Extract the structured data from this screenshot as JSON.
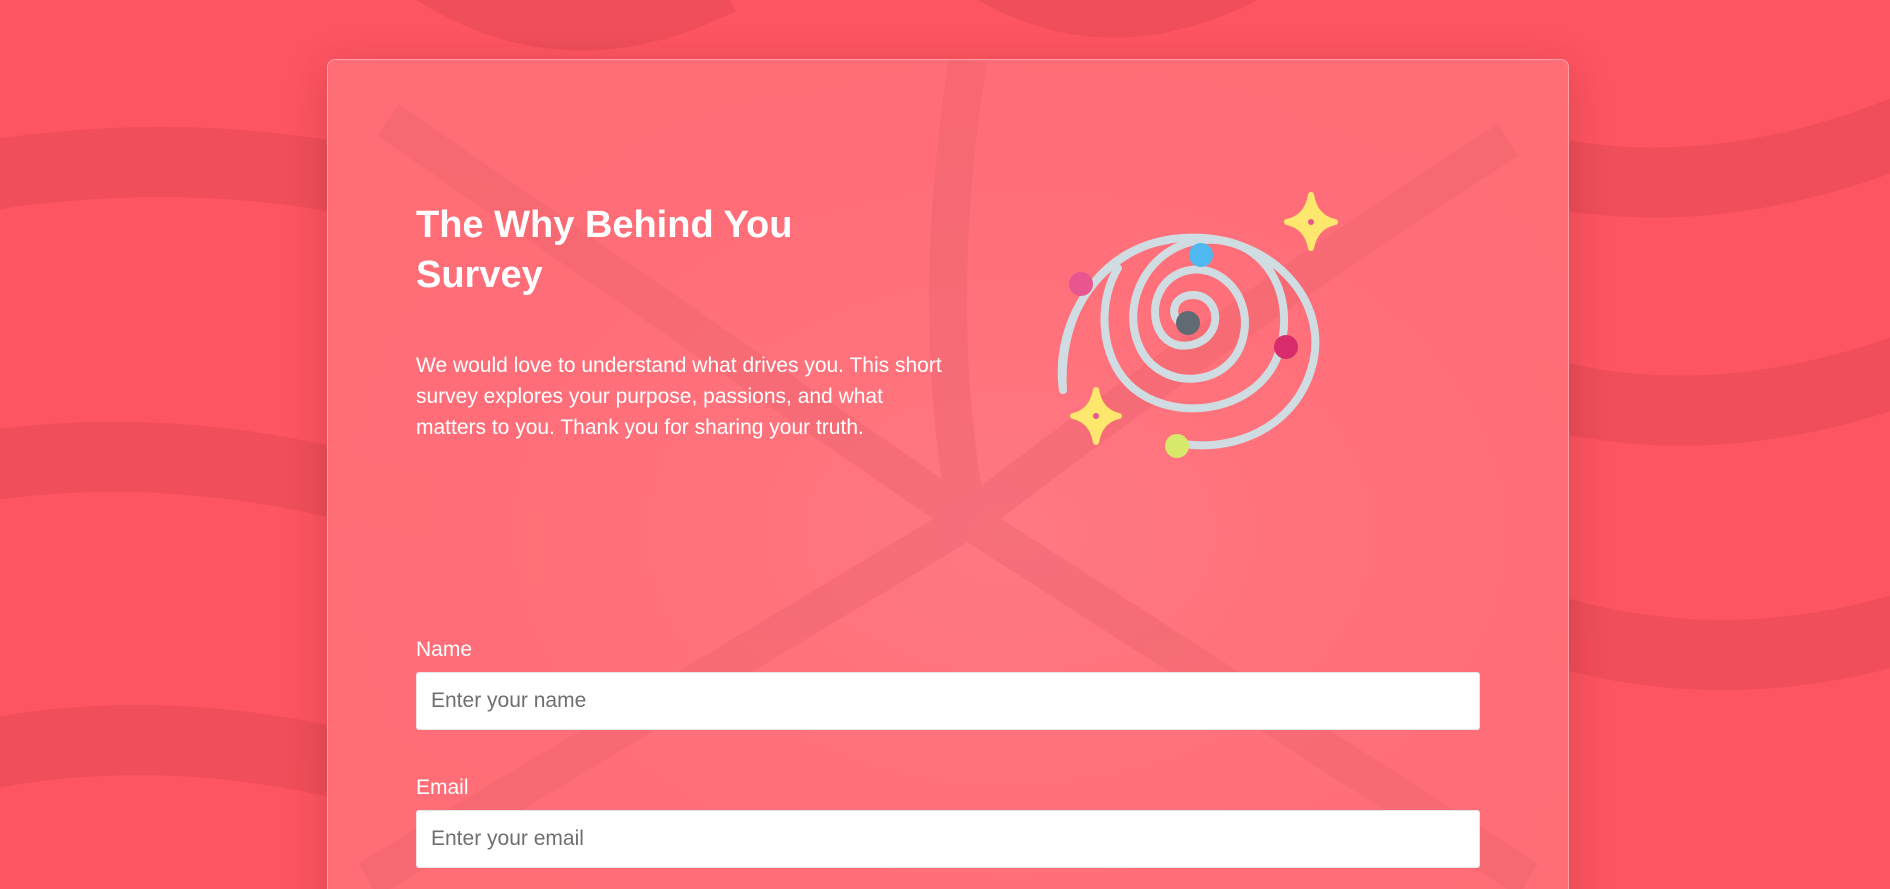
{
  "survey": {
    "title": "The Why Behind You Survey",
    "description": "We would love to understand what drives you. This short survey explores your purpose, passions, and what matters to you. Thank you for sharing your truth."
  },
  "form": {
    "fields": [
      {
        "label": "Name",
        "placeholder": "Enter your name",
        "value": ""
      },
      {
        "label": "Email",
        "placeholder": "Enter your email",
        "value": ""
      }
    ]
  },
  "illustration": {
    "icon": "spiral-galaxy-icon",
    "sparkle_icon": "sparkle-icon"
  },
  "colors": {
    "background": "#fd5561",
    "card": "#ff6e78",
    "spiral": "#cfdde3",
    "sparkle": "#fde86d",
    "dot_blue": "#4fb8f0",
    "dot_pink": "#e8558f",
    "dot_magenta": "#d92c6c",
    "dot_lime": "#d8e86a",
    "core": "#5f6a72"
  }
}
